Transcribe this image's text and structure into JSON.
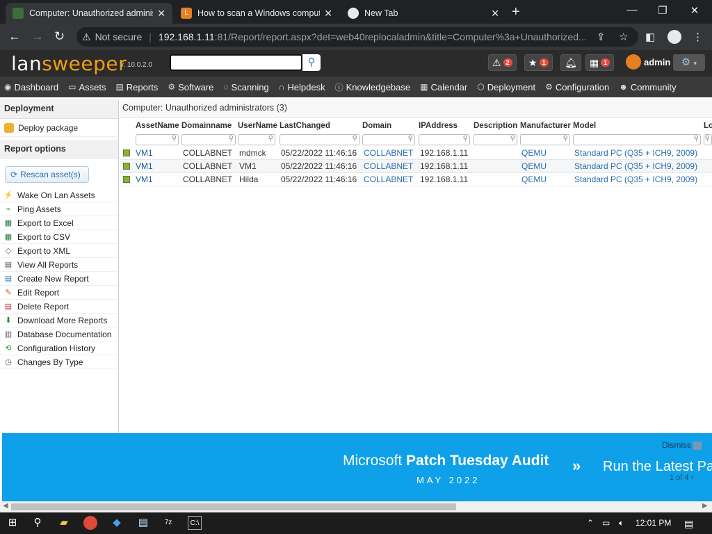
{
  "browser": {
    "tabs": [
      {
        "title": "Computer: Unauthorized adminis",
        "active": true
      },
      {
        "title": "How to scan a Windows compute",
        "active": false
      },
      {
        "title": "New Tab",
        "active": false
      }
    ],
    "new_tab_symbol": "+",
    "window_controls": {
      "minimize": "—",
      "restore": "❐",
      "close": "✕"
    },
    "nav": {
      "back": "←",
      "forward": "→",
      "reload": "↻"
    },
    "address": {
      "security_text": "Not secure",
      "host": "192.168.1.11",
      "rest": ":81/Report/report.aspx?det=web40replocaladmin&title=Computer%3a+Unauthorized..."
    }
  },
  "lansweeper": {
    "logo_part1": "lan",
    "logo_part2": "sweeper",
    "version": "v. 10.0.2.0",
    "search_value": "",
    "alerts_count": "2",
    "favorites_count": "1",
    "calendar_count": "1",
    "user": "admin",
    "colors": {
      "accent": "#f39c12",
      "header_bg": "#2b2b2b",
      "menu_bg": "#3a3a3a",
      "banner_bg": "#0ea0e8"
    }
  },
  "menu": [
    {
      "label": "Dashboard",
      "icon": "dashboard-icon"
    },
    {
      "label": "Assets",
      "icon": "monitor-icon"
    },
    {
      "label": "Reports",
      "icon": "report-icon"
    },
    {
      "label": "Software",
      "icon": "software-icon"
    },
    {
      "label": "Scanning",
      "icon": "scan-icon"
    },
    {
      "label": "Helpdesk",
      "icon": "headset-icon"
    },
    {
      "label": "Knowledgebase",
      "icon": "info-icon"
    },
    {
      "label": "Calendar",
      "icon": "calendar-icon"
    },
    {
      "label": "Deployment",
      "icon": "package-icon"
    },
    {
      "label": "Configuration",
      "icon": "gear-icon"
    },
    {
      "label": "Community",
      "icon": "people-icon"
    }
  ],
  "sidebar": {
    "deployment_header": "Deployment",
    "deploy_package": "Deploy package",
    "options_header": "Report options",
    "rescan_label": "Rescan asset(s)",
    "actions": [
      "Wake On Lan Assets",
      "Ping Assets",
      "Export to Excel",
      "Export to CSV",
      "Export to XML",
      "View All Reports",
      "Create New Report",
      "Edit Report",
      "Delete Report",
      "Download More Reports",
      "Database Documentation",
      "Configuration History",
      "Changes By Type"
    ]
  },
  "report": {
    "title": "Computer: Unauthorized administrators (3)",
    "columns": [
      "AssetName",
      "Domainname",
      "UserName",
      "LastChanged",
      "Domain",
      "IPAddress",
      "Description",
      "Manufacturer",
      "Model",
      "Lo"
    ],
    "rows": [
      [
        "VM1",
        "COLLABNET",
        "mdmck",
        "05/22/2022 11:46:16",
        "COLLABNET",
        "192.168.1.11",
        "",
        "QEMU",
        "Standard PC (Q35 + ICH9, 2009)"
      ],
      [
        "VM1",
        "COLLABNET",
        "VM1",
        "05/22/2022 11:46:16",
        "COLLABNET",
        "192.168.1.11",
        "",
        "QEMU",
        "Standard PC (Q35 + ICH9, 2009)"
      ],
      [
        "VM1",
        "COLLABNET",
        "Hilda",
        "05/22/2022 11:46:16",
        "COLLABNET",
        "192.168.1.11",
        "",
        "QEMU",
        "Standard PC (Q35 + ICH9, 2009)"
      ]
    ]
  },
  "banner": {
    "dismiss": "Dismiss",
    "title_normal": "Microsoft ",
    "title_bold": "Patch Tuesday Audit",
    "subtitle": "MAY 2022",
    "cta": "Run the Latest Pat",
    "pager": "1 of 4"
  },
  "taskbar": {
    "time": "12:01 PM"
  }
}
